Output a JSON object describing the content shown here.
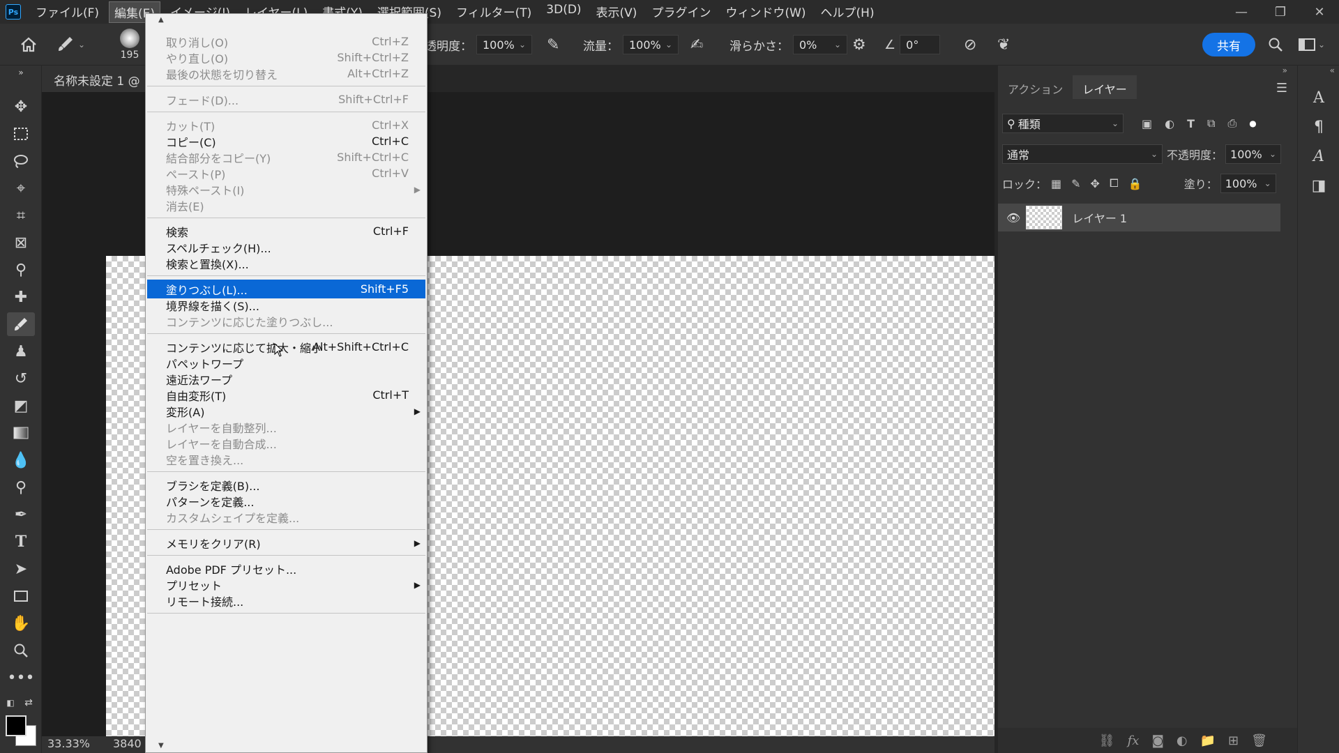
{
  "app": {
    "logo": "Ps"
  },
  "menubar": [
    {
      "label": "ファイル(F)",
      "active": false
    },
    {
      "label": "編集(E)",
      "active": true
    },
    {
      "label": "イメージ(I)",
      "active": false
    },
    {
      "label": "レイヤー(L)",
      "active": false
    },
    {
      "label": "書式(Y)",
      "active": false
    },
    {
      "label": "選択範囲(S)",
      "active": false
    },
    {
      "label": "フィルター(T)",
      "active": false
    },
    {
      "label": "3D(D)",
      "active": false
    },
    {
      "label": "表示(V)",
      "active": false
    },
    {
      "label": "プラグイン",
      "active": false
    },
    {
      "label": "ウィンドウ(W)",
      "active": false
    },
    {
      "label": "ヘルプ(H)",
      "active": false
    }
  ],
  "window_controls": {
    "minimize": "—",
    "restore": "❐",
    "close": "✕"
  },
  "options": {
    "brush_size": "195",
    "opacity_label": "透明度：",
    "opacity_value": "100%",
    "flow_label": "流量：",
    "flow_value": "100%",
    "smoothing_label": "滑らかさ：",
    "smoothing_value": "0%",
    "angle_value": "0°",
    "share_label": "共有"
  },
  "document": {
    "tab_title": "名称未設定 1 @",
    "zoom": "33.33%",
    "size_info": "3840"
  },
  "edit_menu": {
    "items": [
      {
        "label": "取り消し(O)",
        "shortcut": "Ctrl+Z",
        "disabled": true,
        "highlighted": false,
        "submenu": false
      },
      {
        "label": "やり直し(O)",
        "shortcut": "Shift+Ctrl+Z",
        "disabled": true,
        "highlighted": false,
        "submenu": false
      },
      {
        "label": "最後の状態を切り替え",
        "shortcut": "Alt+Ctrl+Z",
        "disabled": true,
        "highlighted": false,
        "submenu": false
      },
      {
        "separator": true
      },
      {
        "label": "フェード(D)...",
        "shortcut": "Shift+Ctrl+F",
        "disabled": true,
        "highlighted": false,
        "submenu": false
      },
      {
        "separator": true
      },
      {
        "label": "カット(T)",
        "shortcut": "Ctrl+X",
        "disabled": true,
        "highlighted": false,
        "submenu": false
      },
      {
        "label": "コピー(C)",
        "shortcut": "Ctrl+C",
        "disabled": false,
        "highlighted": false,
        "submenu": false
      },
      {
        "label": "結合部分をコピー(Y)",
        "shortcut": "Shift+Ctrl+C",
        "disabled": true,
        "highlighted": false,
        "submenu": false
      },
      {
        "label": "ペースト(P)",
        "shortcut": "Ctrl+V",
        "disabled": true,
        "highlighted": false,
        "submenu": false
      },
      {
        "label": "特殊ペースト(I)",
        "shortcut": "",
        "disabled": true,
        "highlighted": false,
        "submenu": true
      },
      {
        "label": "消去(E)",
        "shortcut": "",
        "disabled": true,
        "highlighted": false,
        "submenu": false
      },
      {
        "separator": true
      },
      {
        "label": "検索",
        "shortcut": "Ctrl+F",
        "disabled": false,
        "highlighted": false,
        "submenu": false
      },
      {
        "label": "スペルチェック(H)...",
        "shortcut": "",
        "disabled": false,
        "highlighted": false,
        "submenu": false
      },
      {
        "label": "検索と置換(X)...",
        "shortcut": "",
        "disabled": false,
        "highlighted": false,
        "submenu": false
      },
      {
        "separator": true
      },
      {
        "label": "塗りつぶし(L)...",
        "shortcut": "Shift+F5",
        "disabled": false,
        "highlighted": true,
        "submenu": false
      },
      {
        "label": "境界線を描く(S)...",
        "shortcut": "",
        "disabled": false,
        "highlighted": false,
        "submenu": false
      },
      {
        "label": "コンテンツに応じた塗りつぶし...",
        "shortcut": "",
        "disabled": true,
        "highlighted": false,
        "submenu": false
      },
      {
        "separator": true
      },
      {
        "label": "コンテンツに応じて拡大・縮小",
        "shortcut": "Alt+Shift+Ctrl+C",
        "disabled": false,
        "highlighted": false,
        "submenu": false
      },
      {
        "label": "パペットワープ",
        "shortcut": "",
        "disabled": false,
        "highlighted": false,
        "submenu": false
      },
      {
        "label": "遠近法ワープ",
        "shortcut": "",
        "disabled": false,
        "highlighted": false,
        "submenu": false
      },
      {
        "label": "自由変形(T)",
        "shortcut": "Ctrl+T",
        "disabled": false,
        "highlighted": false,
        "submenu": false
      },
      {
        "label": "変形(A)",
        "shortcut": "",
        "disabled": false,
        "highlighted": false,
        "submenu": true
      },
      {
        "label": "レイヤーを自動整列...",
        "shortcut": "",
        "disabled": true,
        "highlighted": false,
        "submenu": false
      },
      {
        "label": "レイヤーを自動合成...",
        "shortcut": "",
        "disabled": true,
        "highlighted": false,
        "submenu": false
      },
      {
        "label": "空を置き換え...",
        "shortcut": "",
        "disabled": true,
        "highlighted": false,
        "submenu": false
      },
      {
        "separator": true
      },
      {
        "label": "ブラシを定義(B)...",
        "shortcut": "",
        "disabled": false,
        "highlighted": false,
        "submenu": false
      },
      {
        "label": "パターンを定義...",
        "shortcut": "",
        "disabled": false,
        "highlighted": false,
        "submenu": false
      },
      {
        "label": "カスタムシェイプを定義...",
        "shortcut": "",
        "disabled": true,
        "highlighted": false,
        "submenu": false
      },
      {
        "separator": true
      },
      {
        "label": "メモリをクリア(R)",
        "shortcut": "",
        "disabled": false,
        "highlighted": false,
        "submenu": true
      },
      {
        "separator": true
      },
      {
        "label": "Adobe PDF プリセット...",
        "shortcut": "",
        "disabled": false,
        "highlighted": false,
        "submenu": false
      },
      {
        "label": "プリセット",
        "shortcut": "",
        "disabled": false,
        "highlighted": false,
        "submenu": true
      },
      {
        "label": "リモート接続...",
        "shortcut": "",
        "disabled": false,
        "highlighted": false,
        "submenu": false
      },
      {
        "separator": true
      }
    ]
  },
  "layers_panel": {
    "tabs": [
      {
        "label": "アクション",
        "active": false
      },
      {
        "label": "レイヤー",
        "active": true
      }
    ],
    "filter_label": "種類",
    "blend_mode": "通常",
    "opacity_label": "不透明度：",
    "opacity_value": "100%",
    "lock_label": "ロック：",
    "fill_label": "塗り：",
    "fill_value": "100%",
    "layers": [
      {
        "name": "レイヤー 1",
        "visible": true
      }
    ]
  },
  "colors": {
    "accent": "#1473e6",
    "highlight": "#0a68d6",
    "foreground": "#000000",
    "background": "#ffffff"
  }
}
